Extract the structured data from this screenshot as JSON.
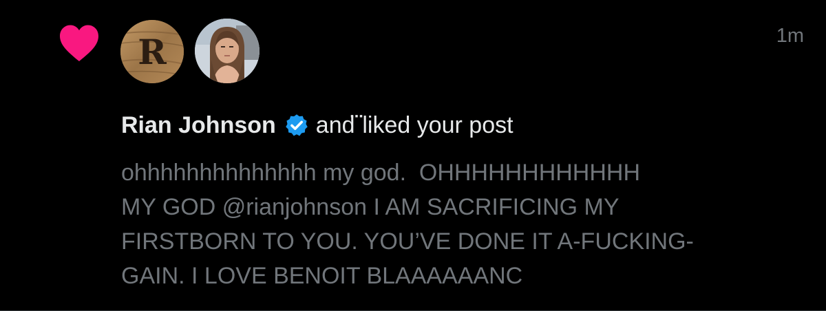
{
  "notification": {
    "timestamp": "1m",
    "author_name": "Rian Johnson",
    "action_text": "and ⃛liked your post",
    "post_lines": [
      "ohhhhhhhhhhhhhh my god.  OHHHHHHHHHHHH",
      "MY GOD @rianjohnson I AM SACRIFICING MY",
      "FIRSTBORN TO YOU. YOU’VE DONE IT A-FUCKING-",
      "GAIN. I LOVE BENOIT BLAAAAAANC"
    ],
    "icons": {
      "like": "heart-icon",
      "verified": "verified-badge-icon"
    },
    "avatars": {
      "first_initial": "R"
    },
    "colors": {
      "background": "#000000",
      "like": "#f91880",
      "verified": "#1d9bf0",
      "primary_text": "#e7e9ea",
      "secondary_text": "#71767b"
    }
  }
}
